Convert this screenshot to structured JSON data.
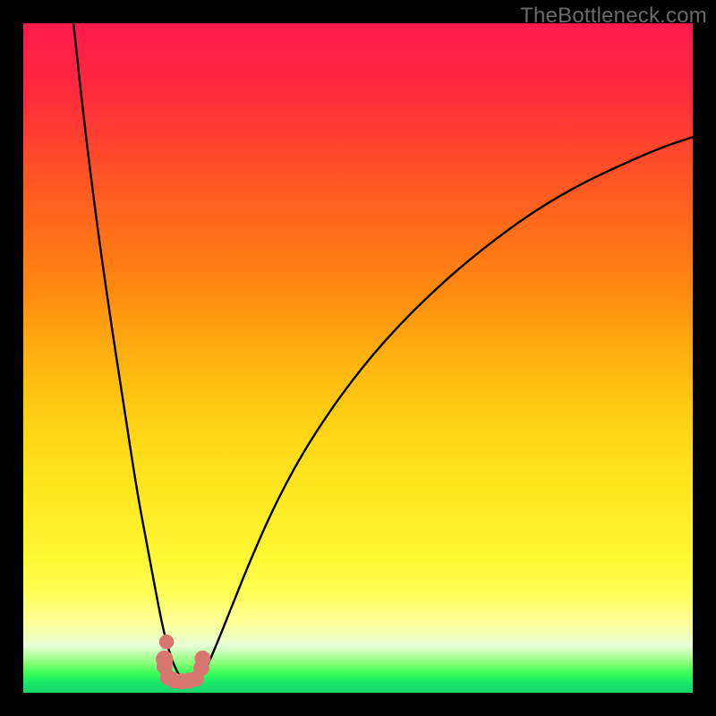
{
  "watermark": "TheBottleneck.com",
  "colors": {
    "background": "#000000",
    "curve": "#000000",
    "dots": "#d7776f"
  },
  "chart_data": {
    "type": "line",
    "title": "",
    "xlabel": "",
    "ylabel": "",
    "xlim": [
      0,
      100
    ],
    "ylim": [
      0,
      100
    ],
    "series": [
      {
        "name": "left-curve",
        "x": [
          7.5,
          9,
          11,
          13,
          15,
          17,
          18.5,
          20,
          21,
          22,
          23,
          23.8
        ],
        "y": [
          100,
          86,
          70,
          56,
          43,
          30,
          22,
          14,
          9,
          5.5,
          3,
          2
        ],
        "comment": "Steep descending branch into the valley minimum"
      },
      {
        "name": "right-curve",
        "x": [
          26.3,
          27.5,
          29,
          31,
          34,
          38,
          43,
          50,
          58,
          68,
          80,
          94,
          100
        ],
        "y": [
          2,
          4,
          7.5,
          12.5,
          20,
          29,
          38,
          48,
          57,
          66,
          74.5,
          81,
          83
        ],
        "comment": "Gradual ascending branch leveling off toward the right"
      },
      {
        "name": "valley-dots",
        "comment": "Salmon-colored data points clustered at the curve minimum",
        "points": [
          {
            "x": 21.4,
            "y": 7.6,
            "r": 1.1
          },
          {
            "x": 21.1,
            "y": 5.0,
            "r": 1.3
          },
          {
            "x": 21.1,
            "y": 3.9,
            "r": 1.2
          },
          {
            "x": 21.6,
            "y": 2.3,
            "r": 1.2
          },
          {
            "x": 22.6,
            "y": 1.8,
            "r": 1.2
          },
          {
            "x": 23.7,
            "y": 1.7,
            "r": 1.2
          },
          {
            "x": 24.7,
            "y": 1.8,
            "r": 1.2
          },
          {
            "x": 25.8,
            "y": 2.1,
            "r": 1.2
          },
          {
            "x": 26.6,
            "y": 3.7,
            "r": 1.2
          },
          {
            "x": 26.8,
            "y": 5.1,
            "r": 1.2
          }
        ]
      }
    ]
  }
}
